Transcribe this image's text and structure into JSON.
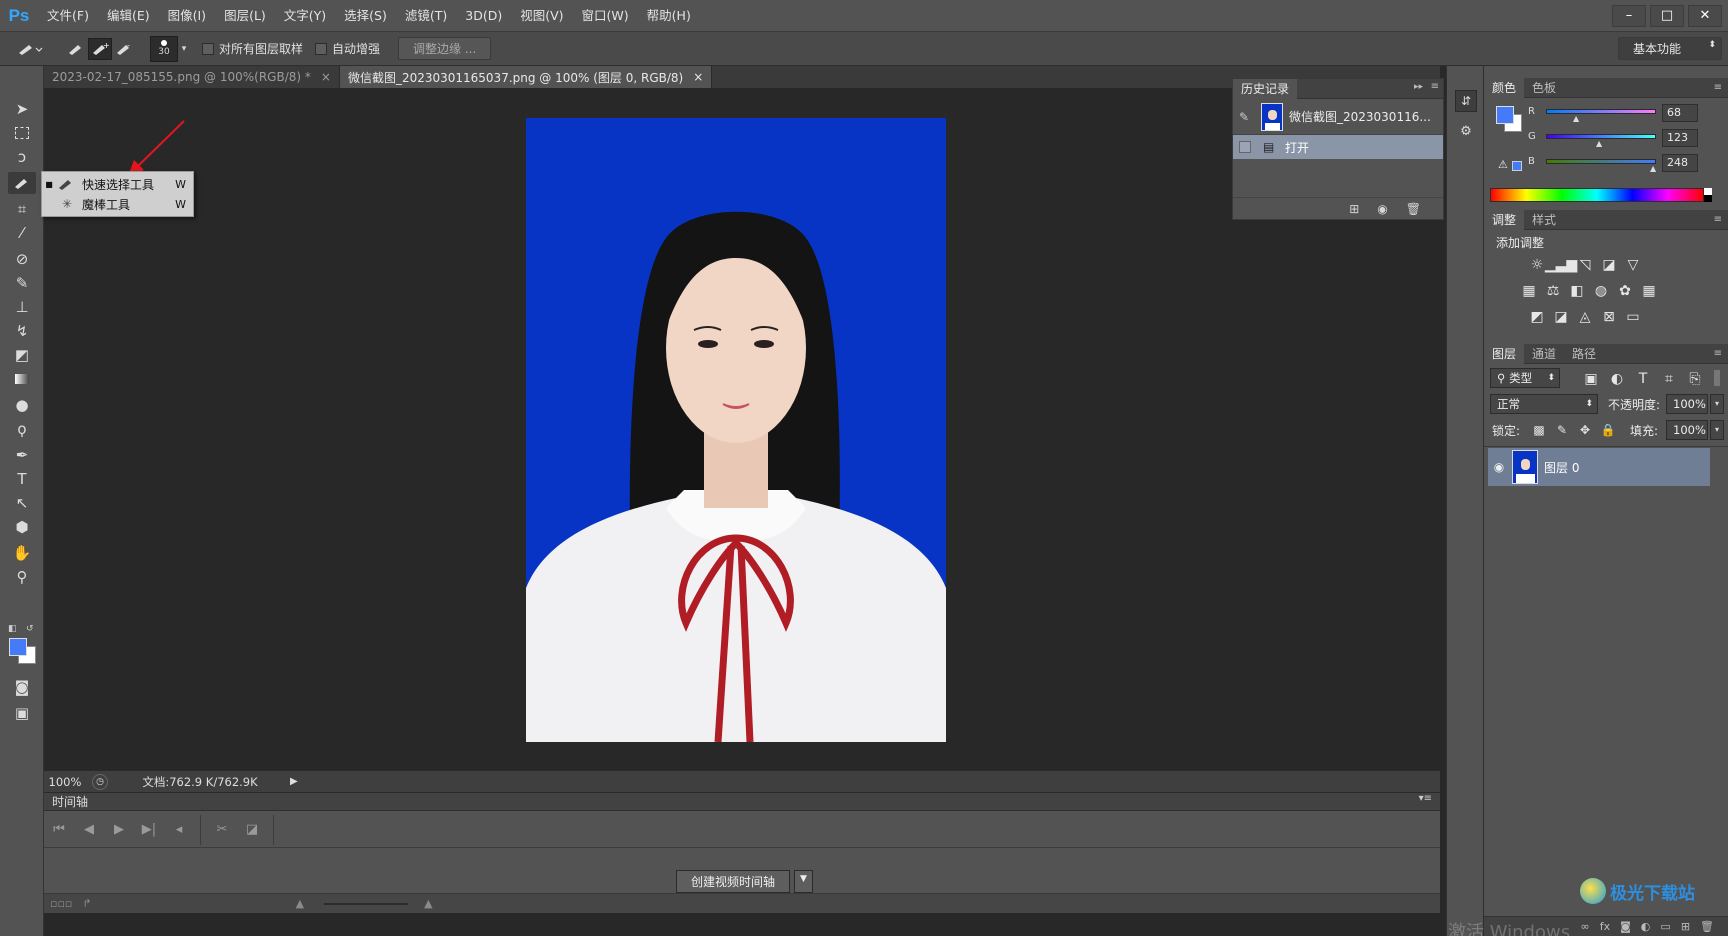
{
  "app": {
    "logo": "Ps"
  },
  "menu": [
    "文件(F)",
    "编辑(E)",
    "图像(I)",
    "图层(L)",
    "文字(Y)",
    "选择(S)",
    "滤镜(T)",
    "3D(D)",
    "视图(V)",
    "窗口(W)",
    "帮助(H)"
  ],
  "window_controls": {
    "minimize": "–",
    "maximize": "□",
    "close": "✕"
  },
  "options": {
    "brush_size": "30",
    "sample_all_layers": "对所有图层取样",
    "auto_enhance": "自动增强",
    "refine_edge": "调整边缘 ...",
    "workspace": "基本功能"
  },
  "tabs": [
    {
      "label": "2023-02-17_085155.png @ 100%(RGB/8) *",
      "close": "×"
    },
    {
      "label": "微信截图_20230301165037.png @ 100% (图层 0, RGB/8)",
      "close": "×"
    }
  ],
  "tool_flyout": [
    {
      "label": "快速选择工具",
      "shortcut": "W",
      "selected": true
    },
    {
      "label": "魔棒工具",
      "shortcut": "W",
      "selected": false
    }
  ],
  "status": {
    "zoom": "100%",
    "doc": "文档:762.9 K/762.9K"
  },
  "timeline": {
    "title": "时间轴",
    "create_button": "创建视频时间轴"
  },
  "history": {
    "title": "历史记录",
    "snapshot": "微信截图_2023030116...",
    "steps": [
      "打开"
    ]
  },
  "color_panel": {
    "tabs": [
      "颜色",
      "色板"
    ],
    "channels": [
      {
        "name": "R",
        "value": "68"
      },
      {
        "name": "G",
        "value": "123"
      },
      {
        "name": "B",
        "value": "248"
      }
    ],
    "foreground": "#447bf8"
  },
  "adjustments": {
    "tabs": [
      "调整",
      "样式"
    ],
    "title": "添加调整"
  },
  "layers_panel": {
    "tabs": [
      "图层",
      "通道",
      "路径"
    ],
    "filter": "类型",
    "blend_mode": "正常",
    "opacity_label": "不透明度:",
    "opacity": "100%",
    "lock_label": "锁定:",
    "fill_label": "填充:",
    "fill": "100%",
    "layers": [
      {
        "name": "图层 0"
      }
    ]
  },
  "watermark": {
    "brand": "极光下载站",
    "activate": "激活 Windows"
  },
  "colors": {
    "photo_bg": "#0734c4",
    "accent": "#31a8ff"
  }
}
